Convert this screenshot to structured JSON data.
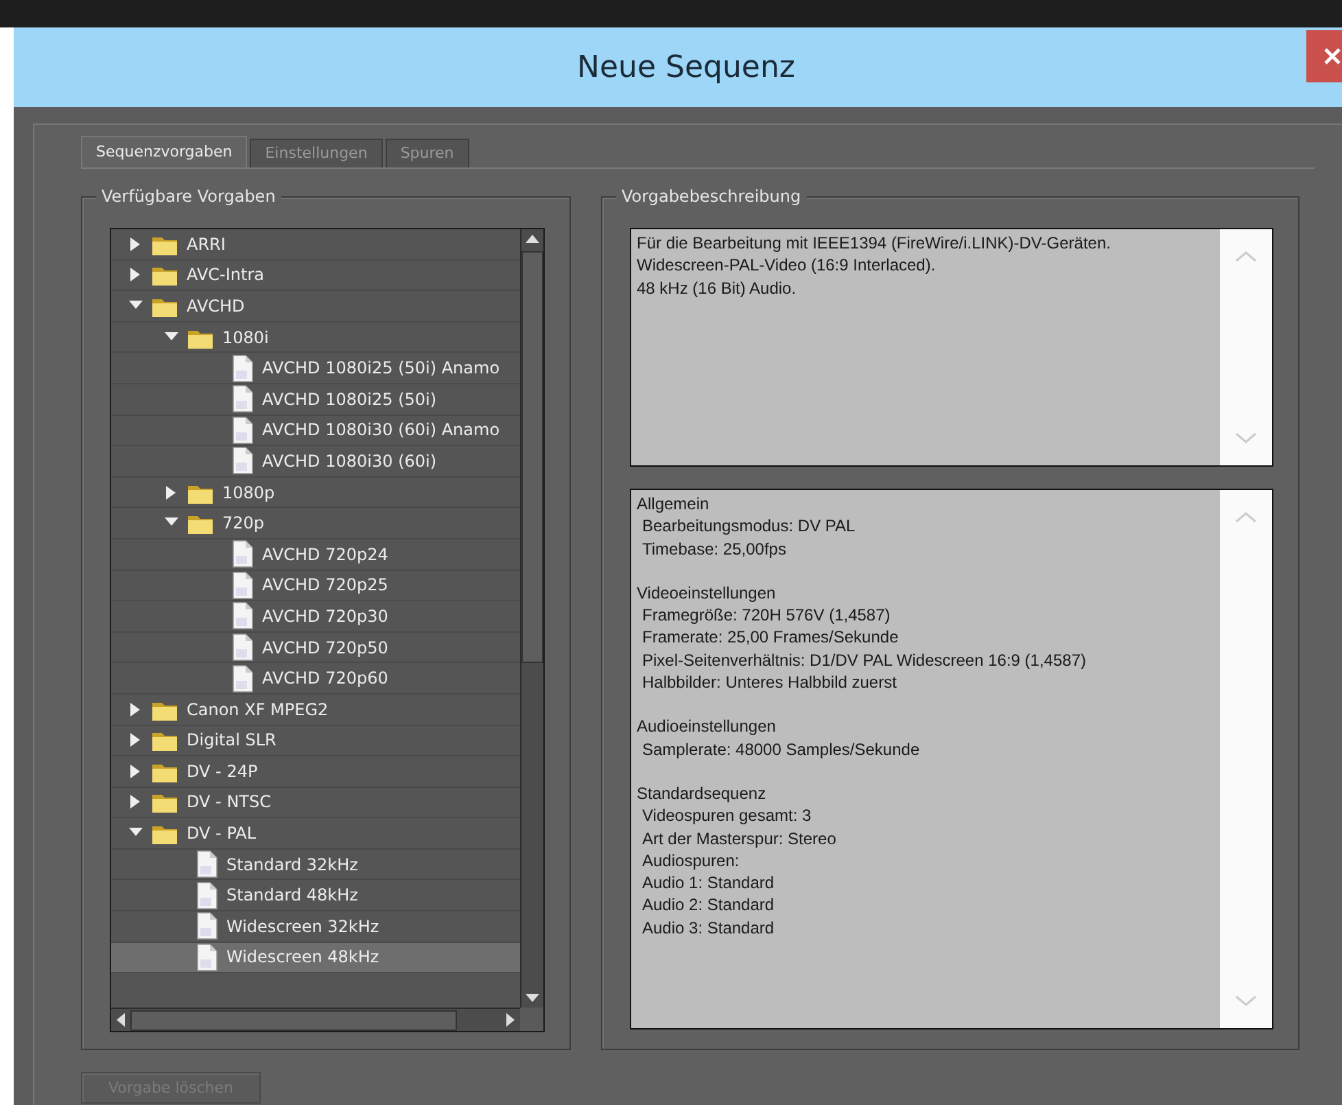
{
  "window": {
    "title": "Neue Sequenz"
  },
  "tabs": [
    {
      "label": "Sequenzvorgaben",
      "selected": true
    },
    {
      "label": "Einstellungen",
      "selected": false
    },
    {
      "label": "Spuren",
      "selected": false
    }
  ],
  "presets": {
    "title": "Verfügbare Vorgaben",
    "items": [
      {
        "label": "ARRI",
        "kind": "folder",
        "expanded": false,
        "selected": false
      },
      {
        "label": "AVC-Intra",
        "kind": "folder",
        "expanded": false,
        "selected": false
      },
      {
        "label": "AVCHD",
        "kind": "folder",
        "expanded": true,
        "selected": false,
        "children": [
          {
            "label": "1080i",
            "kind": "folder",
            "expanded": true,
            "selected": false,
            "children": [
              {
                "label": "AVCHD 1080i25 (50i) Anamo",
                "kind": "preset",
                "selected": false
              },
              {
                "label": "AVCHD 1080i25 (50i)",
                "kind": "preset",
                "selected": false
              },
              {
                "label": "AVCHD 1080i30 (60i) Anamo",
                "kind": "preset",
                "selected": false
              },
              {
                "label": "AVCHD 1080i30 (60i)",
                "kind": "preset",
                "selected": false
              }
            ]
          },
          {
            "label": "1080p",
            "kind": "folder",
            "expanded": false,
            "selected": false
          },
          {
            "label": "720p",
            "kind": "folder",
            "expanded": true,
            "selected": false,
            "children": [
              {
                "label": "AVCHD 720p24",
                "kind": "preset",
                "selected": false
              },
              {
                "label": "AVCHD 720p25",
                "kind": "preset",
                "selected": false
              },
              {
                "label": "AVCHD 720p30",
                "kind": "preset",
                "selected": false
              },
              {
                "label": "AVCHD 720p50",
                "kind": "preset",
                "selected": false
              },
              {
                "label": "AVCHD 720p60",
                "kind": "preset",
                "selected": false
              }
            ]
          }
        ]
      },
      {
        "label": "Canon XF MPEG2",
        "kind": "folder",
        "expanded": false,
        "selected": false
      },
      {
        "label": "Digital SLR",
        "kind": "folder",
        "expanded": false,
        "selected": false
      },
      {
        "label": "DV - 24P",
        "kind": "folder",
        "expanded": false,
        "selected": false
      },
      {
        "label": "DV - NTSC",
        "kind": "folder",
        "expanded": false,
        "selected": false
      },
      {
        "label": "DV - PAL",
        "kind": "folder",
        "expanded": true,
        "selected": false,
        "children": [
          {
            "label": "Standard 32kHz",
            "kind": "preset",
            "selected": false
          },
          {
            "label": "Standard 48kHz",
            "kind": "preset",
            "selected": false
          },
          {
            "label": "Widescreen 32kHz",
            "kind": "preset",
            "selected": false
          },
          {
            "label": "Widescreen 48kHz",
            "kind": "preset",
            "selected": true
          }
        ]
      }
    ]
  },
  "description": {
    "title": "Vorgabebeschreibung",
    "lines": [
      "Für die Bearbeitung mit IEEE1394 (FireWire/i.LINK)-DV-Geräten.",
      "Widescreen-PAL-Video (16:9 Interlaced).",
      "48 kHz (16 Bit) Audio."
    ]
  },
  "details": {
    "sections": [
      {
        "heading": "Allgemein",
        "lines": [
          "Bearbeitungsmodus: DV PAL",
          "Timebase: 25,00fps"
        ]
      },
      {
        "heading": "Videoeinstellungen",
        "lines": [
          "Framegröße: 720H 576V (1,4587)",
          "Framerate: 25,00 Frames/Sekunde",
          "Pixel-Seitenverhältnis: D1/DV PAL Widescreen 16:9 (1,4587)",
          "Halbbilder: Unteres Halbbild zuerst"
        ]
      },
      {
        "heading": "Audioeinstellungen",
        "lines": [
          "Samplerate: 48000 Samples/Sekunde"
        ]
      },
      {
        "heading": "Standardsequenz",
        "lines": [
          "Videospuren gesamt: 3",
          "Art der Masterspur: Stereo",
          "Audiospuren:",
          "Audio 1: Standard",
          "Audio 2: Standard",
          "Audio 3: Standard"
        ]
      }
    ]
  },
  "delete_button": {
    "label": "Vorgabe löschen",
    "disabled": true
  }
}
